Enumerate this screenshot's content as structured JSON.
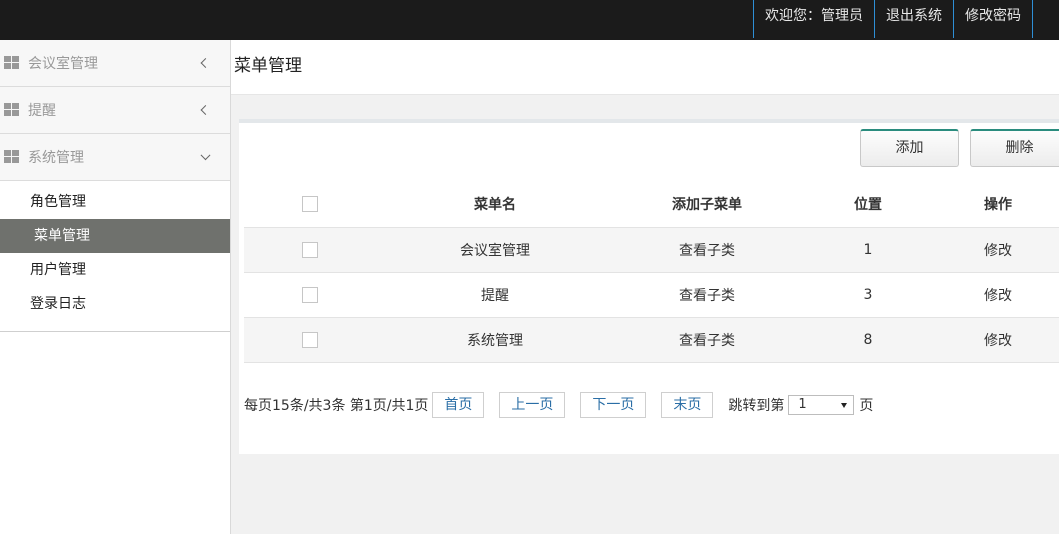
{
  "topbar": {
    "welcome": "欢迎您：管理员",
    "logout": "退出系统",
    "change_password": "修改密码"
  },
  "sidebar": {
    "groups": [
      {
        "label": "会议室管理",
        "icon": "grid-icon",
        "state": "collapsed"
      },
      {
        "label": "提醒",
        "icon": "grid-icon",
        "state": "collapsed"
      },
      {
        "label": "系统管理",
        "icon": "grid-icon",
        "state": "expanded"
      }
    ],
    "sub_items": [
      {
        "label": "角色管理"
      },
      {
        "label": "菜单管理",
        "active": true
      },
      {
        "label": "用户管理"
      },
      {
        "label": "登录日志"
      }
    ]
  },
  "page": {
    "title": "菜单管理"
  },
  "toolbar": {
    "add_label": "添加",
    "delete_label": "删除"
  },
  "table": {
    "headers": [
      "菜单名",
      "添加子菜单",
      "位置",
      "操作"
    ],
    "rows": [
      {
        "name": "会议室管理",
        "child": "查看子类",
        "position": "1",
        "action": "修改"
      },
      {
        "name": "提醒",
        "child": "查看子类",
        "position": "3",
        "action": "修改"
      },
      {
        "name": "系统管理",
        "child": "查看子类",
        "position": "8",
        "action": "修改"
      }
    ]
  },
  "pager": {
    "info": "每页15条/共3条 第1页/共1页",
    "first": "首页",
    "prev": "上一页",
    "next": "下一页",
    "last": "末页",
    "jump_prefix": "跳转到第",
    "jump_value": "1",
    "jump_suffix": "页"
  },
  "colors": {
    "topbar": "#1b1b1b",
    "active_item": "#6f716d",
    "divider_blue": "#2e8fd6",
    "button_accent": "#2a8c7e"
  }
}
